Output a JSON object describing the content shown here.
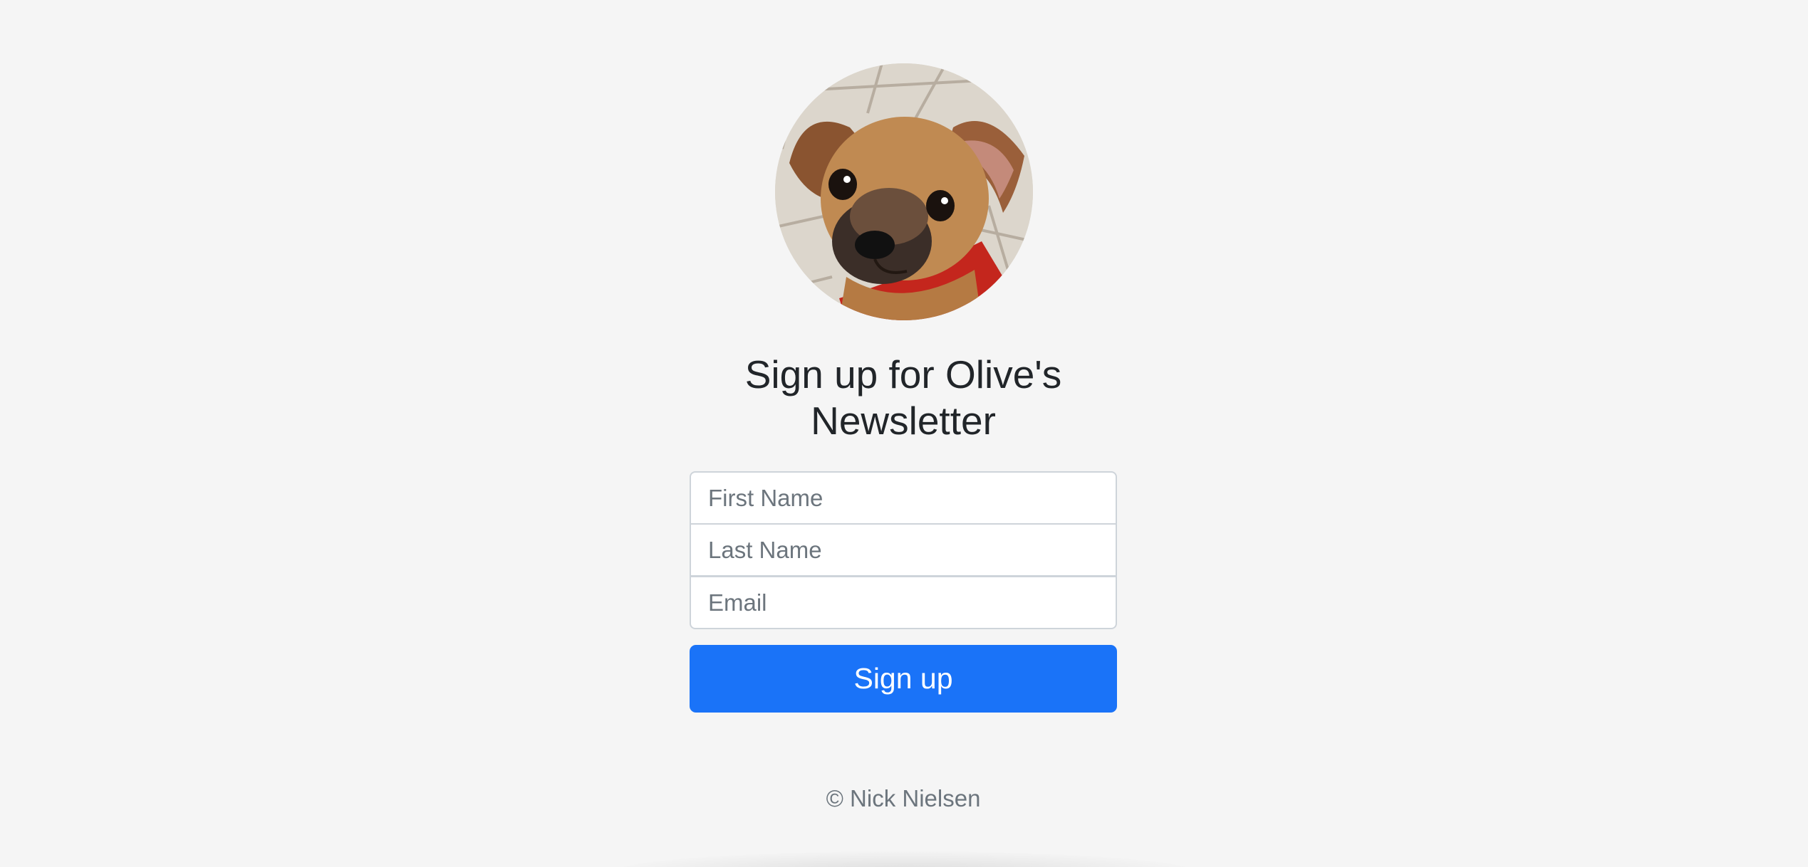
{
  "form": {
    "avatar_alt": "Olive the puppy",
    "heading_line1": "Sign up for Olive's",
    "heading_line2": "Newsletter",
    "first_name_placeholder": "First Name",
    "last_name_placeholder": "Last Name",
    "email_placeholder": "Email",
    "first_name_value": "",
    "last_name_value": "",
    "email_value": "",
    "submit_label": "Sign up"
  },
  "footer": {
    "copyright": "© Nick Nielsen"
  },
  "colors": {
    "background": "#f5f5f5",
    "primary_button": "#1a73f8",
    "muted_text": "#6c757d",
    "heading_text": "#212529"
  }
}
